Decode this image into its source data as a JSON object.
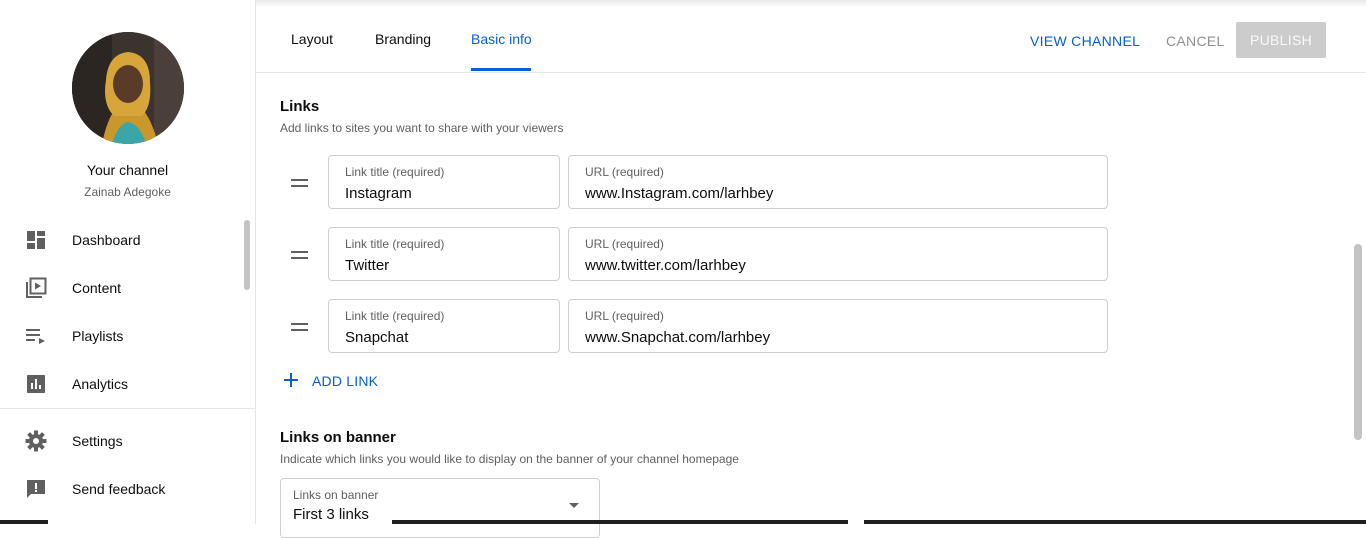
{
  "sidebar": {
    "channel_title": "Your channel",
    "channel_name": "Zainab Adegoke",
    "items": [
      {
        "label": "Dashboard",
        "icon": "dashboard-icon"
      },
      {
        "label": "Content",
        "icon": "content-icon"
      },
      {
        "label": "Playlists",
        "icon": "playlists-icon"
      },
      {
        "label": "Analytics",
        "icon": "analytics-icon"
      },
      {
        "label": "Settings",
        "icon": "gear-icon"
      },
      {
        "label": "Send feedback",
        "icon": "feedback-icon"
      }
    ]
  },
  "header": {
    "tabs": [
      {
        "label": "Layout",
        "active": false
      },
      {
        "label": "Branding",
        "active": false
      },
      {
        "label": "Basic info",
        "active": true
      }
    ],
    "view_channel": "VIEW CHANNEL",
    "cancel": "CANCEL",
    "publish": "PUBLISH"
  },
  "links_section": {
    "title": "Links",
    "description": "Add links to sites you want to share with your viewers",
    "links": [
      {
        "title_label": "Link title (required)",
        "title": "Instagram",
        "url_label": "URL (required)",
        "url": "www.Instagram.com/larhbey"
      },
      {
        "title_label": "Link title (required)",
        "title": "Twitter",
        "url_label": "URL (required)",
        "url": "www.twitter.com/larhbey"
      },
      {
        "title_label": "Link title (required)",
        "title": "Snapchat",
        "url_label": "URL (required)",
        "url": "www.Snapchat.com/larhbey"
      }
    ],
    "add_link": "ADD LINK"
  },
  "banner_section": {
    "title": "Links on banner",
    "description": "Indicate which links you would like to display on the banner of your channel homepage",
    "select_label": "Links on banner",
    "select_value": "First 3 links"
  },
  "colors": {
    "accent": "#065fd4",
    "publish_disabled": "#cccccc"
  }
}
